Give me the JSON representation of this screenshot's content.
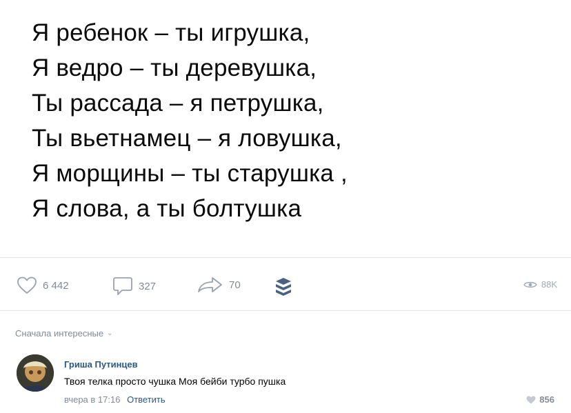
{
  "poem": {
    "lines": [
      "Я ребенок – ты игрушка,",
      "Я ведро – ты деревушка,",
      "Ты рассада – я петрушка,",
      "Ты вьетнамец – я ловушка,",
      "Я морщины – ты старушка ,",
      "Я слова, а ты болтушка"
    ]
  },
  "actions": {
    "likes": "6 442",
    "comments": "327",
    "shares": "70",
    "views": "88K"
  },
  "comments_section": {
    "sort_label": "Сначала интересные"
  },
  "comment": {
    "author": "Гриша Путинцев",
    "text": "Твоя телка просто чушка Моя бейби турбо пушка",
    "time": "вчера в 17:16",
    "reply_label": "Ответить",
    "likes": "856"
  },
  "colors": {
    "link": "#2a5885",
    "muted": "#828a99",
    "divider": "#e2e4e8"
  }
}
